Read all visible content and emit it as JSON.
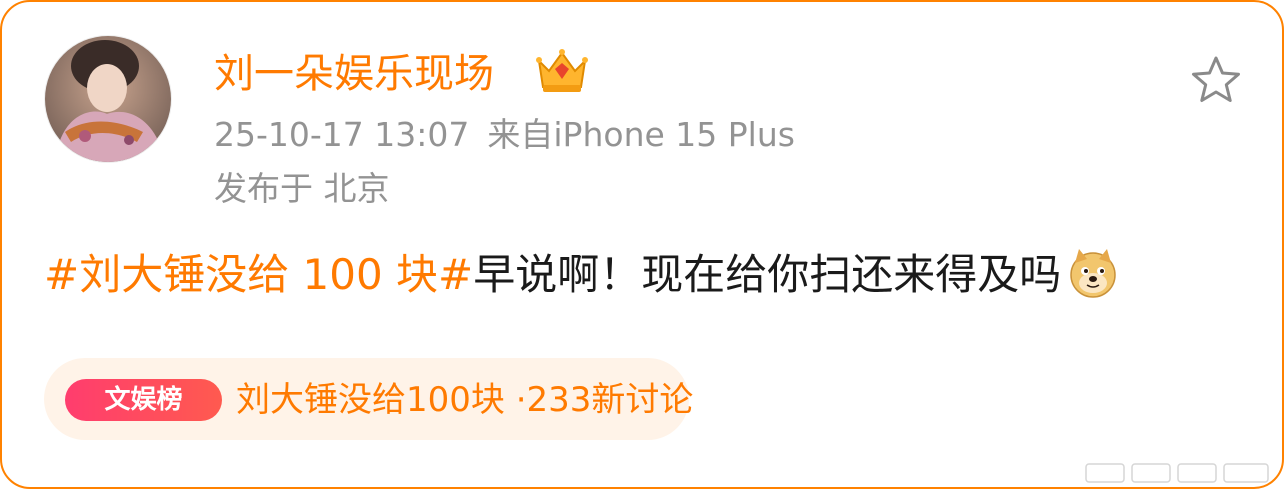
{
  "post": {
    "author_name": "刘一朵娱乐现场",
    "timestamp": "25-10-17 13:07",
    "source": "来自iPhone 15 Plus",
    "location": "发布于 北京",
    "topic": "#刘大锤没给 100 块#",
    "body": "早说啊！现在给你扫还来得及吗"
  },
  "trend": {
    "badge_label": "文娱榜",
    "text": "刘大锤没给100块 ·233新讨论"
  },
  "icons": {
    "verified": "crown-badge-icon",
    "favorite": "star-icon",
    "emoji": "doge-emoji-icon"
  },
  "colors": {
    "accent": "#ff7a00",
    "frame": "#ff8200",
    "meta": "#939393",
    "badge": "#ff3d6e",
    "pill_bg": "#fff3e8"
  }
}
